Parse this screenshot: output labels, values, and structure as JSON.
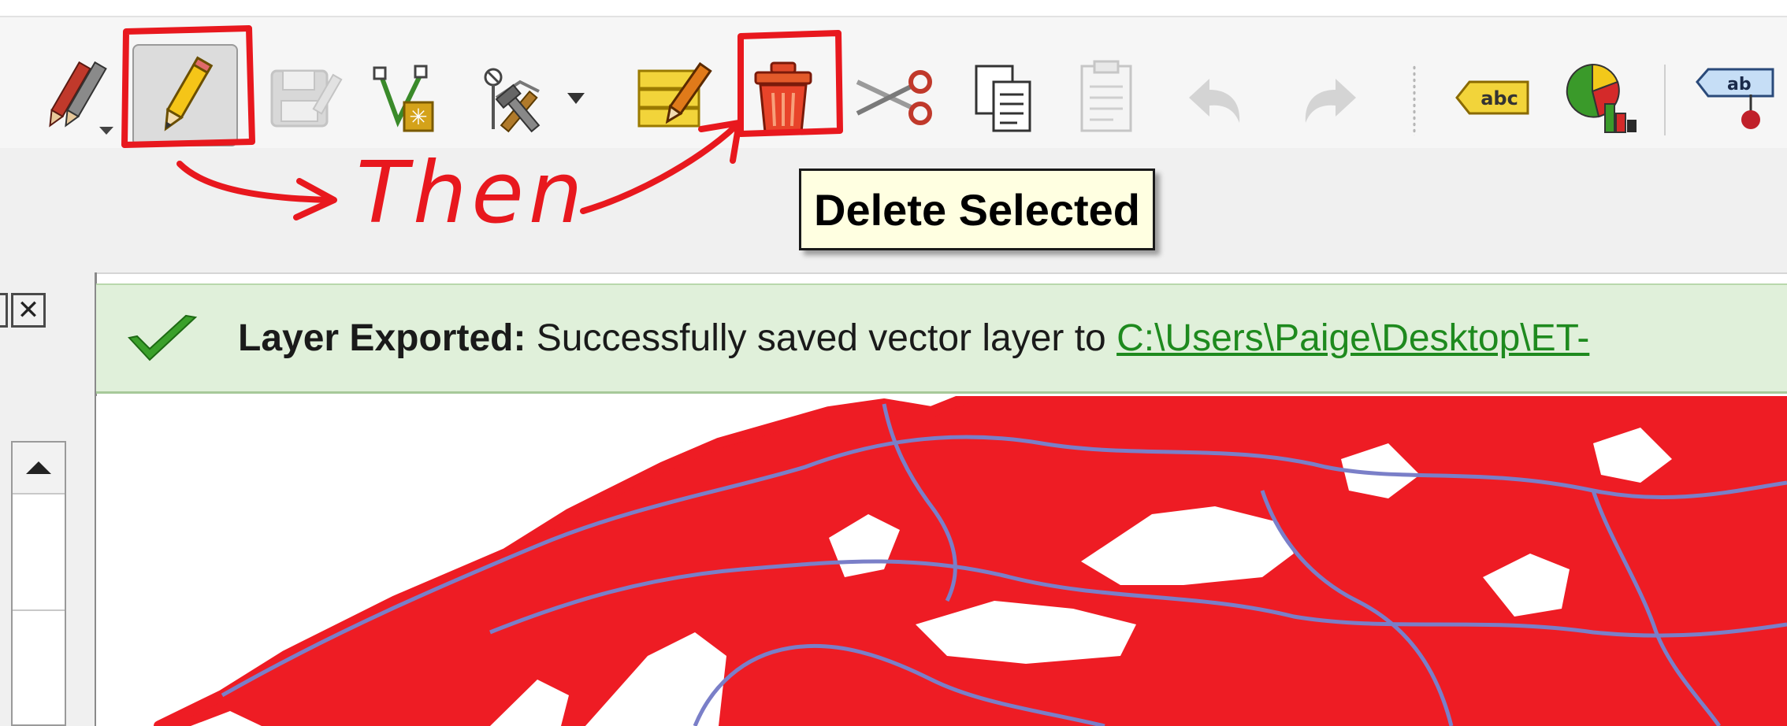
{
  "toolbar": {
    "tools": [
      {
        "name": "current-edits",
        "icon": "pencils-dropdown-icon"
      },
      {
        "name": "toggle-editing",
        "icon": "pencil-icon",
        "pressed": true
      },
      {
        "name": "save-layer-edits",
        "icon": "save-edits-icon",
        "enabled": false
      },
      {
        "name": "add-feature",
        "icon": "add-vertex-feature-icon"
      },
      {
        "name": "digitizing-tools",
        "icon": "node-tool-icon"
      },
      {
        "name": "modify-attributes",
        "icon": "edit-table-icon"
      },
      {
        "name": "delete-selected",
        "icon": "trash-icon"
      },
      {
        "name": "cut-features",
        "icon": "scissors-icon"
      },
      {
        "name": "copy-features",
        "icon": "copy-icon"
      },
      {
        "name": "paste-features",
        "icon": "paste-icon",
        "enabled": false
      },
      {
        "name": "undo",
        "icon": "undo-icon",
        "enabled": false
      },
      {
        "name": "redo",
        "icon": "redo-icon",
        "enabled": false
      },
      {
        "name": "label-toolbar",
        "icon": "abc-label-icon",
        "badge": "abc"
      },
      {
        "name": "diagram-options",
        "icon": "diagram-icon"
      },
      {
        "name": "pin-labels",
        "icon": "pin-label-icon",
        "badge": "ab"
      }
    ]
  },
  "tooltip": {
    "text": "Delete Selected"
  },
  "annotation": {
    "text": "Then",
    "color": "#e8181e"
  },
  "message_bar": {
    "title": "Layer Exported:",
    "text": " Successfully saved vector layer to ",
    "link": "C:\\Users\\Paige\\Desktop\\ET-"
  },
  "map": {
    "fill_color": "#ee1c24",
    "line_color": "#7a7fc8"
  },
  "colors": {
    "accent_red": "#e8181e",
    "message_bg": "#e0f0da",
    "link": "#1e8a1e"
  }
}
